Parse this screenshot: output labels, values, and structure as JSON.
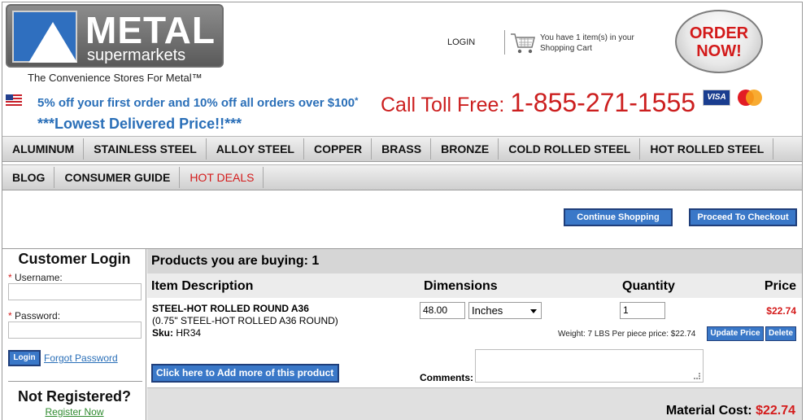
{
  "header": {
    "logo": {
      "metal": "METAL",
      "super": "supermarkets"
    },
    "tagline": "The Convenience Stores For Metal™",
    "login": "LOGIN",
    "cart_text": "You have 1 item(s) in your Shopping Cart",
    "order_now_line1": "ORDER",
    "order_now_line2": "NOW!",
    "promo": "5% off your first order and 10% off all orders over $100",
    "promo_star": "*",
    "call_label": "Call Toll Free:",
    "call_number": "1-855-271-1555",
    "visa_label": "VISA",
    "lowest": "***Lowest Delivered Price!!***"
  },
  "nav_primary": [
    {
      "label": "ALUMINUM"
    },
    {
      "label": "STAINLESS STEEL"
    },
    {
      "label": "ALLOY STEEL"
    },
    {
      "label": "COPPER"
    },
    {
      "label": "BRASS"
    },
    {
      "label": "BRONZE"
    },
    {
      "label": "COLD ROLLED STEEL"
    },
    {
      "label": "HOT ROLLED STEEL"
    }
  ],
  "nav_secondary": [
    {
      "label": "BLOG"
    },
    {
      "label": "CONSUMER GUIDE"
    },
    {
      "label": "HOT DEALS"
    }
  ],
  "actions": {
    "continue": "Continue Shopping",
    "checkout": "Proceed To Checkout"
  },
  "sidebar": {
    "title": "Customer Login",
    "username_label": "Username:",
    "password_label": "Password:",
    "required_mark": "*",
    "login_btn": "Login",
    "forgot": "Forgot Password",
    "not_registered": "Not Registered?",
    "register": "Register Now"
  },
  "cart": {
    "heading": "Products you are buying: 1",
    "col_item": "Item Description",
    "col_dimensions": "Dimensions",
    "col_quantity": "Quantity",
    "col_price": "Price",
    "item": {
      "title": "STEEL-HOT ROLLED ROUND A36",
      "subtitle": "(0.75\" STEEL-HOT ROLLED A36 ROUND)",
      "sku_label": "Sku:",
      "sku": "HR34",
      "dimension": "48.00",
      "unit": "Inches",
      "quantity": "1",
      "price": "$22.74",
      "weight": "Weight: 7 LBS Per piece price: $22.74"
    },
    "update_btn": "Update Price",
    "delete_btn": "Delete",
    "add_more": "Click here to Add more of this product",
    "comments_label": "Comments:",
    "material_label": "Material Cost:",
    "material_value": "$22.74"
  },
  "colors": {
    "accent_blue": "#3a78c8",
    "price_red": "#d41b1b",
    "promo_blue": "#2a6fb8"
  }
}
